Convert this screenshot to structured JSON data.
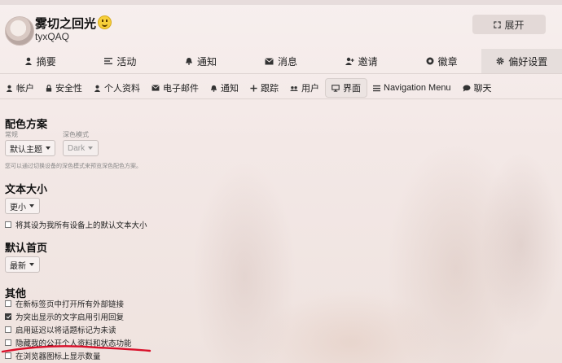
{
  "header": {
    "username": "雾切之回光",
    "handle": "tyxQAQ",
    "expand_label": "展开"
  },
  "nav_main": [
    {
      "label": "摘要",
      "icon": "person-icon"
    },
    {
      "label": "活动",
      "icon": "list-icon"
    },
    {
      "label": "通知",
      "icon": "bell-icon"
    },
    {
      "label": "消息",
      "icon": "envelope-icon"
    },
    {
      "label": "邀请",
      "icon": "user-plus-icon"
    },
    {
      "label": "徽章",
      "icon": "badge-icon"
    },
    {
      "label": "偏好设置",
      "icon": "gear-icon",
      "active": true
    }
  ],
  "nav_prefs": [
    {
      "label": "帐户",
      "icon": "person-icon"
    },
    {
      "label": "安全性",
      "icon": "lock-icon"
    },
    {
      "label": "个人资料",
      "icon": "person-icon"
    },
    {
      "label": "电子邮件",
      "icon": "envelope-icon"
    },
    {
      "label": "通知",
      "icon": "bell-icon"
    },
    {
      "label": "跟踪",
      "icon": "plus-icon"
    },
    {
      "label": "用户",
      "icon": "users-icon"
    },
    {
      "label": "界面",
      "icon": "desktop-icon",
      "active": true
    },
    {
      "label": "Navigation Menu",
      "icon": "bars-icon"
    },
    {
      "label": "聊天",
      "icon": "chat-icon"
    }
  ],
  "color_scheme": {
    "title": "配色方案",
    "regular_label": "常规",
    "regular_value": "默认主题",
    "dark_label": "深色模式",
    "dark_value": "Dark",
    "hint": "您可以通过切换设备的深色模式来预览深色配色方案。"
  },
  "text_size": {
    "title": "文本大小",
    "value": "更小",
    "checkbox_label": "将其设为我所有设备上的默认文本大小"
  },
  "default_home": {
    "title": "默认首页",
    "value": "最新"
  },
  "other": {
    "title": "其他",
    "options": [
      {
        "label": "在新标签页中打开所有外部链接",
        "checked": false
      },
      {
        "label": "为突出显示的文字启用引用回复",
        "checked": true
      },
      {
        "label": "启用延迟以将话题标记为未读",
        "checked": false
      },
      {
        "label": "隐藏我的公开个人资料和状态功能",
        "checked": false
      },
      {
        "label": "在浏览器图标上显示数量",
        "checked": false
      }
    ]
  },
  "colors": {
    "annotation_red": "#d9102a",
    "active_tab_bg": "#e6dedc"
  }
}
